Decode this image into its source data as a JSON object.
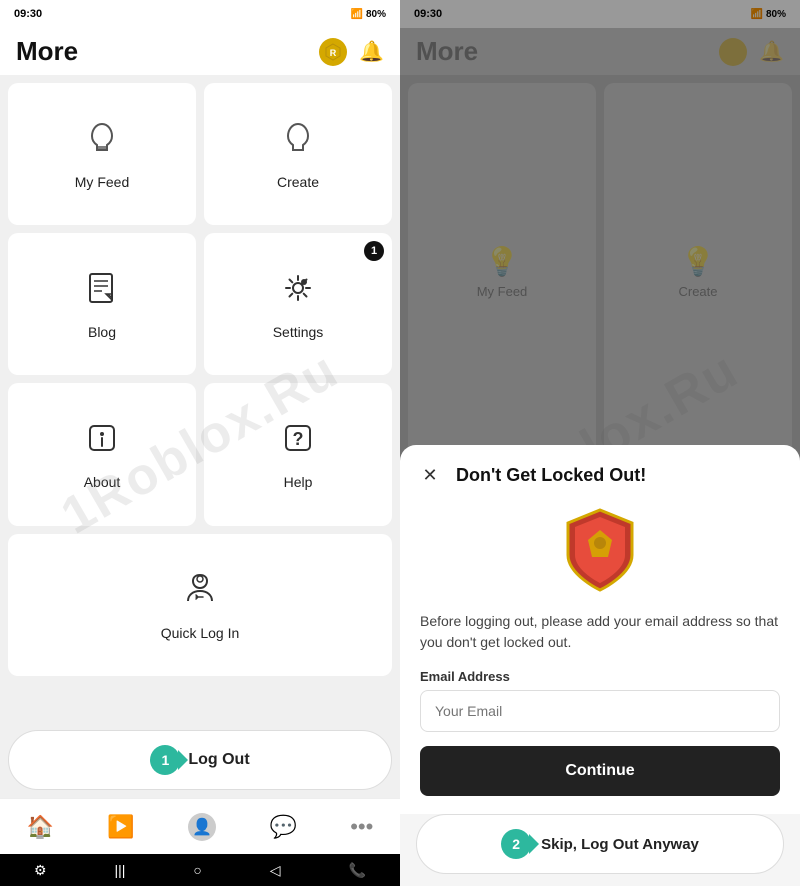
{
  "left_phone": {
    "status_time": "09:30",
    "status_icons": "M ☰ ✦",
    "battery": "80%",
    "header_title": "More",
    "menu_items": [
      {
        "id": "my-feed",
        "label": "My Feed",
        "icon": "feed",
        "badge": null
      },
      {
        "id": "create",
        "label": "Create",
        "icon": "create",
        "badge": null
      },
      {
        "id": "blog",
        "label": "Blog",
        "icon": "blog",
        "badge": null
      },
      {
        "id": "settings",
        "label": "Settings",
        "icon": "settings",
        "badge": "1"
      },
      {
        "id": "about",
        "label": "About",
        "icon": "about",
        "badge": null
      },
      {
        "id": "help",
        "label": "Help",
        "icon": "help",
        "badge": null
      },
      {
        "id": "quick-login",
        "label": "Quick Log In",
        "icon": "quick-login",
        "badge": null
      }
    ],
    "logout_label": "Log Out",
    "step_number": "1",
    "nav_items": [
      "home",
      "play",
      "avatar",
      "chat",
      "more"
    ]
  },
  "right_phone": {
    "status_time": "09:30",
    "battery": "80%",
    "header_title": "More",
    "modal": {
      "title": "Don't Get Locked Out!",
      "description": "Before logging out, please add your email address so that you don't get locked out.",
      "email_label": "Email Address",
      "email_placeholder": "Your Email",
      "continue_label": "Continue",
      "skip_label": "Skip, Log Out Anyway",
      "step_number": "2"
    }
  }
}
